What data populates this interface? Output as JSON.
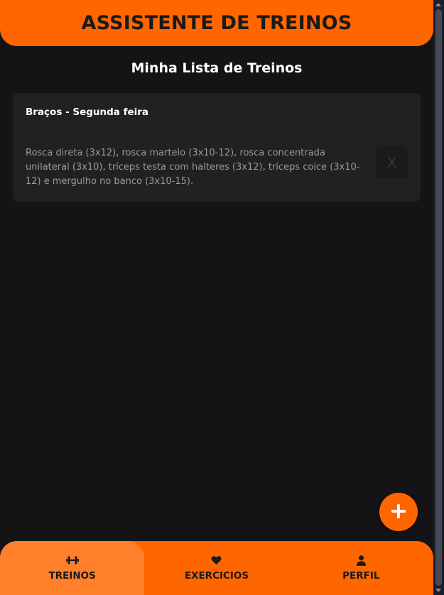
{
  "header": {
    "title": "ASSISTENTE DE TREINOS"
  },
  "main": {
    "title": "Minha Lista de Treinos"
  },
  "workouts": [
    {
      "title": "Braços - Segunda feira",
      "description": "Rosca direta (3x12), rosca martelo (3x10-12), rosca concentrada unilateral (3x10), tríceps testa com halteres (3x12), tríceps coice (3x10-12) e mergulho no banco (3x10-15).",
      "delete_label": "X"
    }
  ],
  "fab": {
    "icon": "plus-icon"
  },
  "bottom_nav": {
    "items": [
      {
        "label": "TREINOS",
        "icon": "dumbbell-icon",
        "active": true
      },
      {
        "label": "EXERCICIOS",
        "icon": "heart-icon",
        "active": false
      },
      {
        "label": "PERFIL",
        "icon": "user-icon",
        "active": false
      }
    ]
  },
  "colors": {
    "accent": "#ff6600",
    "active_tab": "#ff7f2a",
    "background": "#141416",
    "card": "#212123"
  }
}
